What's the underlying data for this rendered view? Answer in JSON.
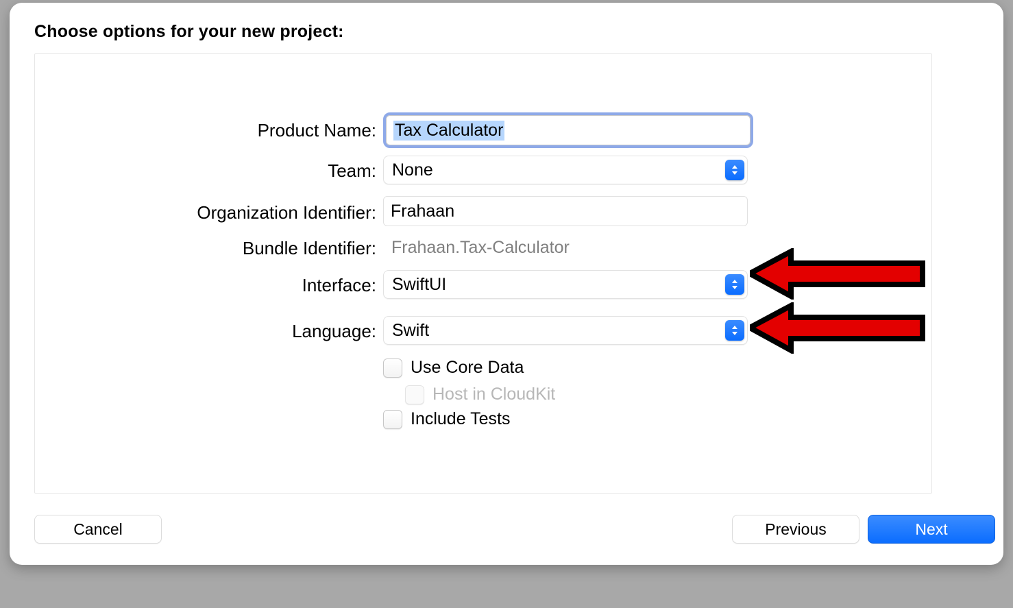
{
  "heading": "Choose options for your new project:",
  "labels": {
    "product_name": "Product Name:",
    "team": "Team:",
    "org_identifier": "Organization Identifier:",
    "bundle_identifier": "Bundle Identifier:",
    "interface": "Interface:",
    "language": "Language:"
  },
  "fields": {
    "product_name": "Tax Calculator",
    "team": "None",
    "org_identifier": "Frahaan",
    "bundle_identifier": "Frahaan.Tax-Calculator",
    "interface": "SwiftUI",
    "language": "Swift"
  },
  "checkboxes": {
    "use_core_data": "Use Core Data",
    "host_cloudkit": "Host in CloudKit",
    "include_tests": "Include Tests"
  },
  "buttons": {
    "cancel": "Cancel",
    "previous": "Previous",
    "next": "Next"
  }
}
